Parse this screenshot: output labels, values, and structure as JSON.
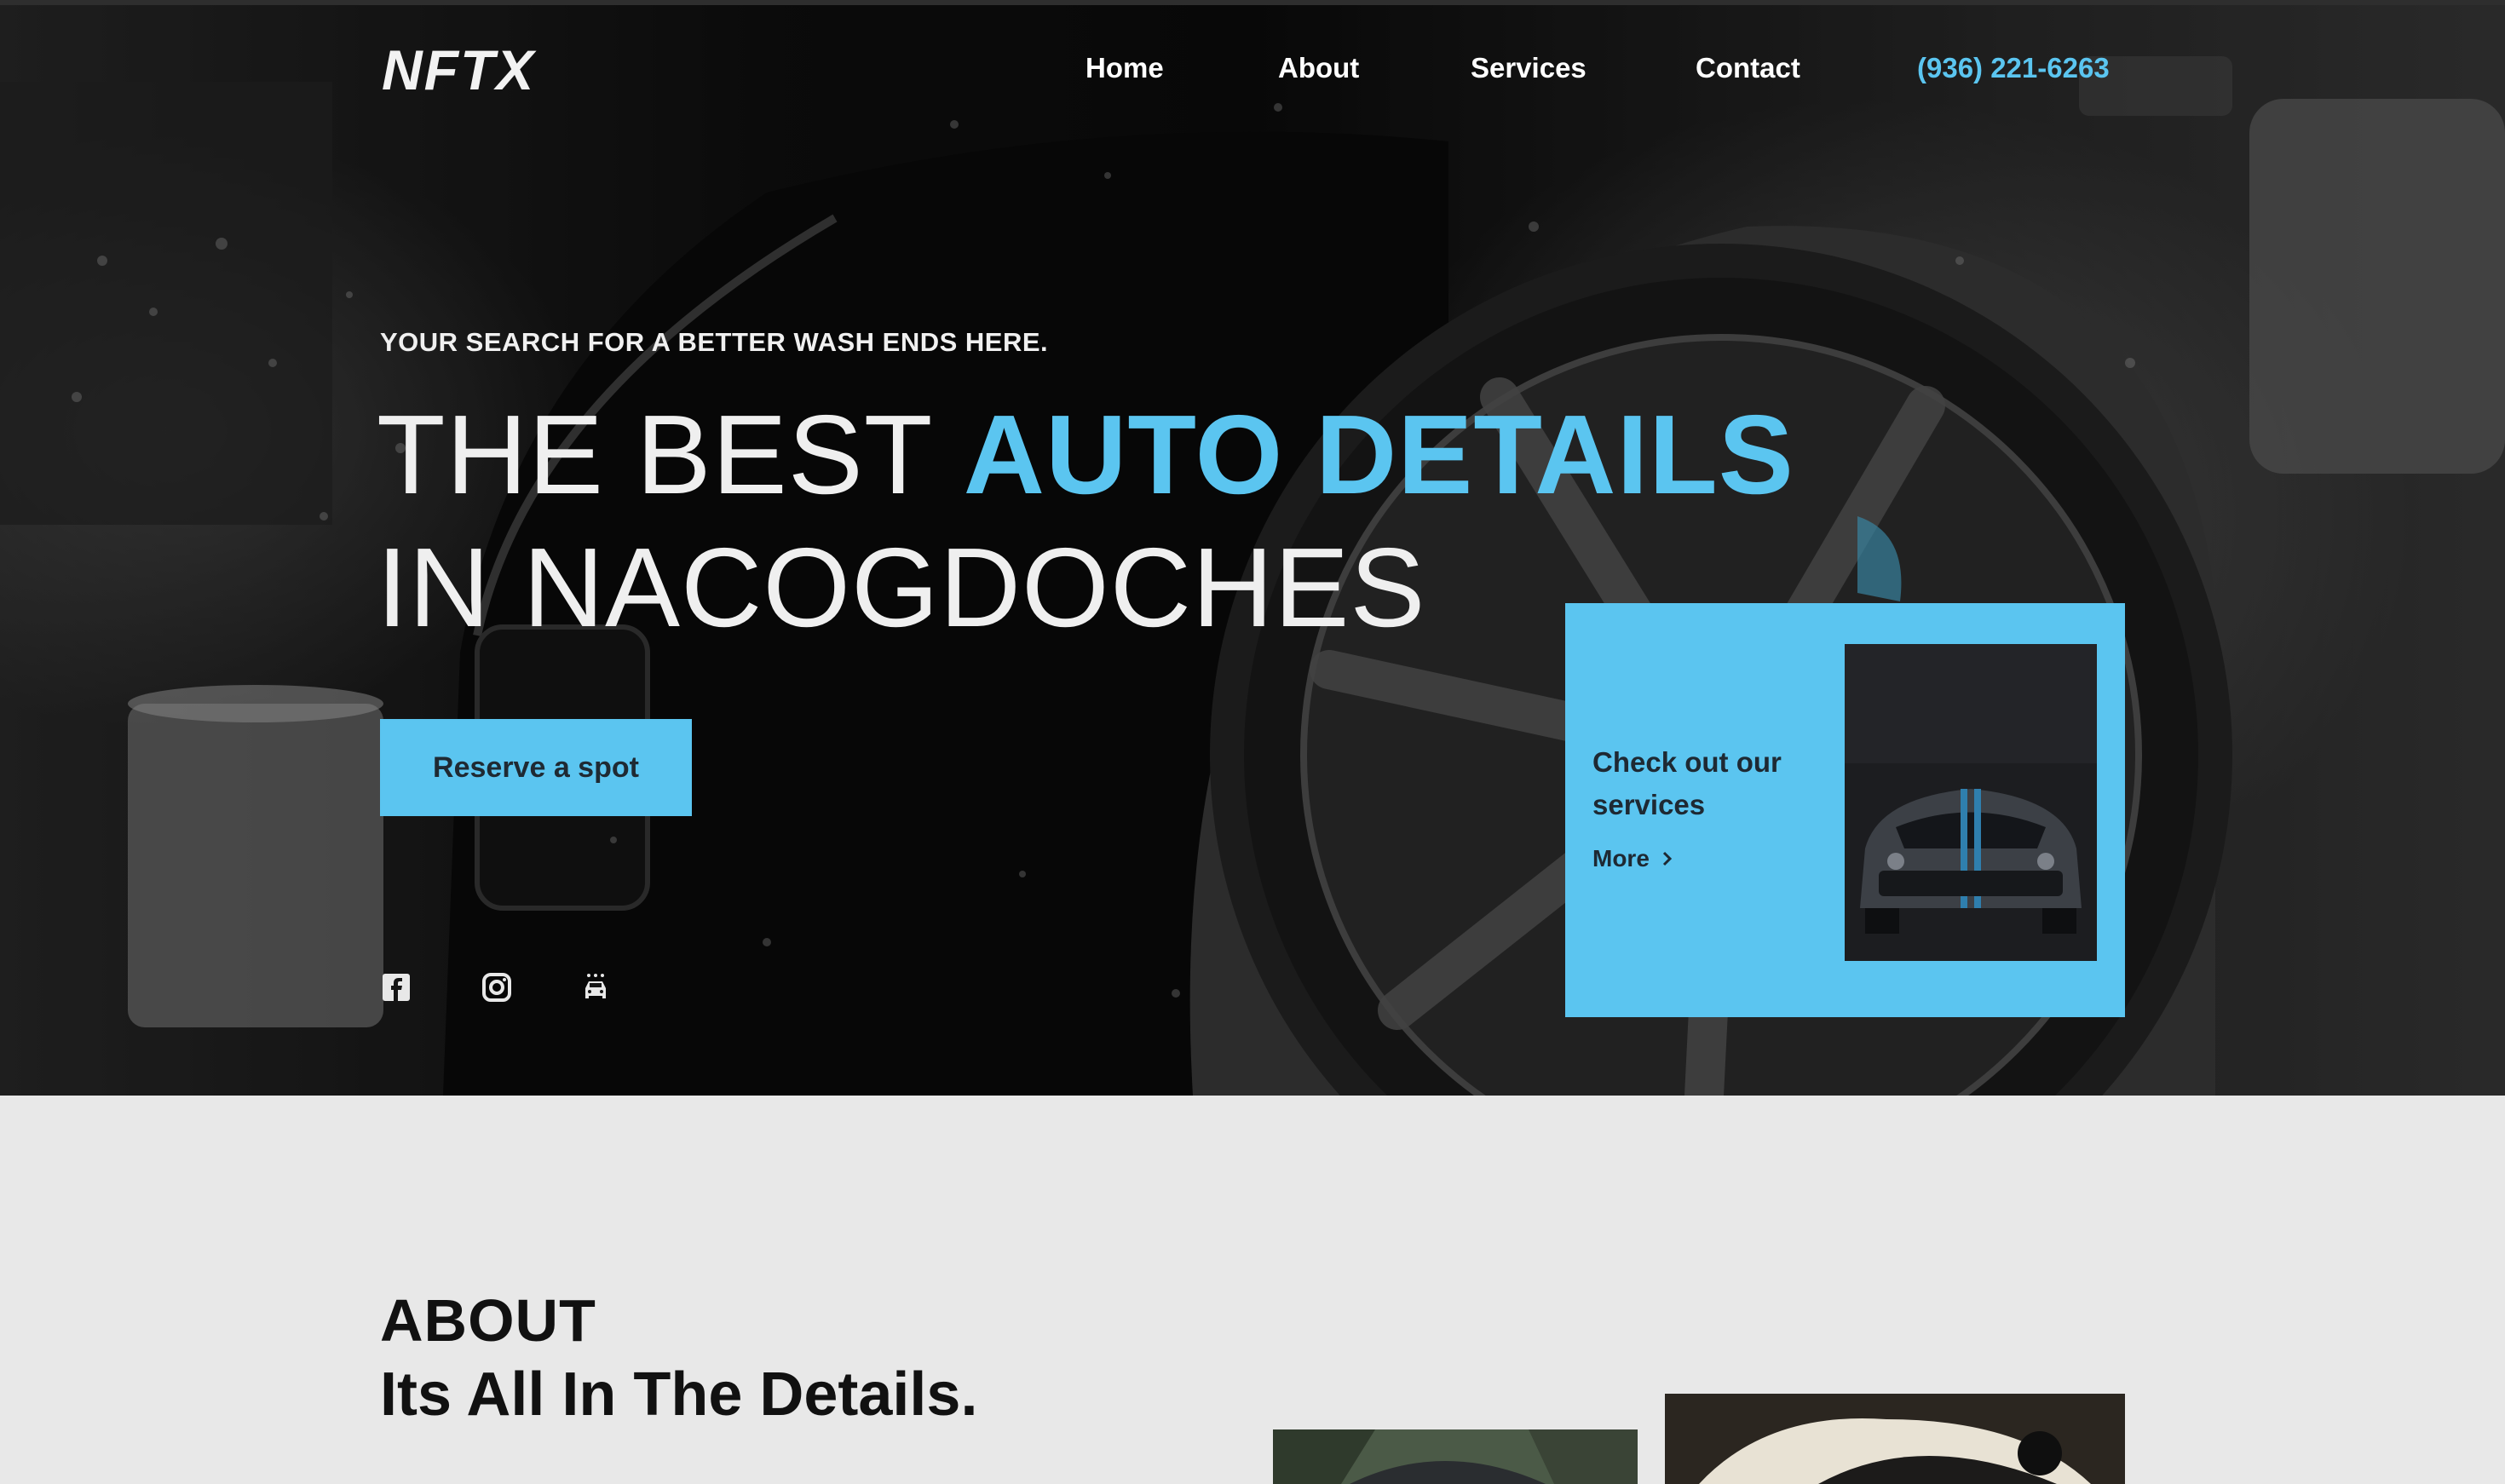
{
  "brand": {
    "logo": "NFTX"
  },
  "nav": {
    "items": [
      {
        "label": "Home"
      },
      {
        "label": "About"
      },
      {
        "label": "Services"
      },
      {
        "label": "Contact"
      }
    ],
    "phone": "(936) 221-6263"
  },
  "hero": {
    "tagline": "YOUR SEARCH FOR A BETTER WASH ENDS HERE.",
    "headline_part1": "THE BEST ",
    "headline_highlight": "AUTO DETAILS",
    "headline_line2": "IN NACOGDOCHES",
    "cta_label": "Reserve a spot",
    "social_icons": [
      "facebook-icon",
      "instagram-icon",
      "car-wash-icon"
    ]
  },
  "services_card": {
    "title": "Check out our services",
    "more_label": "More"
  },
  "about": {
    "label": "ABOUT",
    "title": "Its All In The Details."
  },
  "colors": {
    "accent": "#5bc5f0",
    "hero_dark": "#0c0c0c",
    "page_bg": "#e8e8e8",
    "card_text": "#1e2933"
  }
}
